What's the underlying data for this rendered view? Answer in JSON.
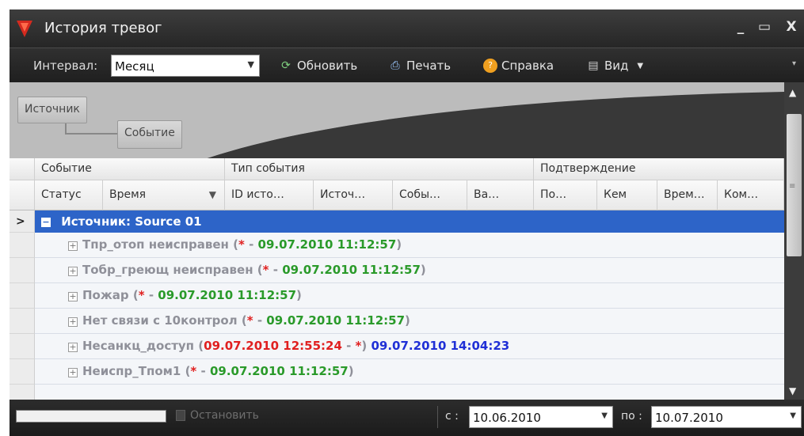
{
  "window": {
    "title": "История тревог",
    "minimize": "_",
    "maximize": "▭",
    "close": "X"
  },
  "toolbar": {
    "interval_label": "Интервал:",
    "interval_value": "Месяц",
    "refresh_label": "Обновить",
    "print_label": "Печать",
    "help_label": "Справка",
    "view_label": "Вид"
  },
  "group_panel": {
    "chips": [
      "Источник",
      "Событие"
    ]
  },
  "grid": {
    "header_groups": [
      "Событие",
      "Тип события",
      "Подтверждение"
    ],
    "columns": [
      "Статус",
      "Время",
      "ID исто…",
      "Источ…",
      "Собы…",
      "Ва…",
      "По…",
      "Кем",
      "Врем…",
      "Ком…"
    ],
    "group_row": "Источник: Source 01",
    "rows": [
      {
        "name": "Тпр_отоп неисправен",
        "star": "*",
        "sep": " - ",
        "time": "09.07.2010 11:12:57"
      },
      {
        "name": "Тобр_греющ неисправен",
        "star": "*",
        "sep": " - ",
        "time": "09.07.2010 11:12:57"
      },
      {
        "name": "Пожар",
        "star": "*",
        "sep": " - ",
        "time": "09.07.2010 11:12:57"
      },
      {
        "name": "Нет связи с 10контрол",
        "star": "*",
        "sep": " - ",
        "time": "09.07.2010 11:12:57"
      },
      {
        "name": "Несанкц_доступ",
        "start": "09.07.2010 12:55:24",
        "sep": " - ",
        "star": "*",
        "end": "09.07.2010 14:04:23"
      },
      {
        "name": "Неиспр_Тпом1",
        "star": "*",
        "sep": " - ",
        "time": "09.07.2010 11:12:57"
      }
    ]
  },
  "statusbar": {
    "stop_label": "Остановить",
    "from_label": "c :",
    "from_value": "10.06.2010",
    "to_label": "по :",
    "to_value": "10.07.2010"
  },
  "colors": {
    "accent": "#2d64c8",
    "ok": "#2a9a2a",
    "alarm": "#e02020",
    "closed": "#1f2fd6"
  },
  "icons": [
    "app-logo-icon",
    "refresh-icon",
    "print-icon",
    "help-icon",
    "view-icon",
    "stop-icon"
  ]
}
